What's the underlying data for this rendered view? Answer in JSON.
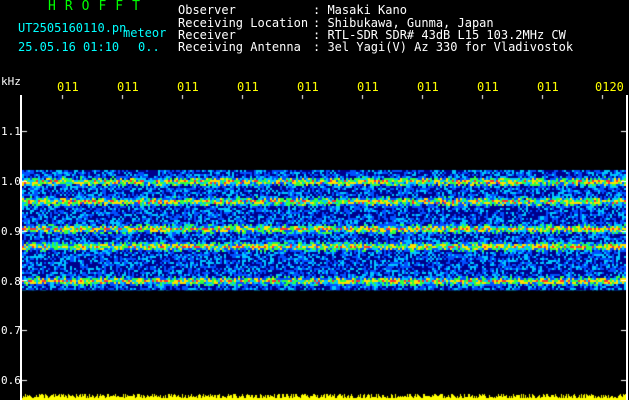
{
  "header": {
    "logo": "HROFFT",
    "filename": "UT2505160110.pn",
    "filename_suffix": "meteor",
    "datetime": "25.05.16 01:10",
    "dot_text": "0..",
    "fields": [
      {
        "label": "Observer",
        "value": ": Masaki Kano"
      },
      {
        "label": "Receiving Location",
        "value": ": Shibukawa, Gunma, Japan"
      },
      {
        "label": "Receiver",
        "value": ": RTL-SDR SDR# 43dB L15 103.2MHz CW"
      },
      {
        "label": "Receiving Antenna",
        "value": ": 3el Yagi(V) Az 330 for Vladivostok"
      }
    ]
  },
  "axis": {
    "unit": "kHz",
    "y_labels": [
      "1.1",
      "1.0",
      "0.9",
      "0.8",
      "0.7",
      "0.6"
    ],
    "x_labels": [
      "011",
      "011",
      "011",
      "011",
      "011",
      "011",
      "011",
      "011",
      "011",
      "0120"
    ]
  },
  "colors": {
    "grid": "#ffffff",
    "signal_low": "#0000c0",
    "signal_mid": "#00c8ff",
    "signal_high": "#ff2020",
    "level_bar": "#ffff00",
    "logo": "#00ff00"
  },
  "spectrogram": {
    "band_khz": [
      0.78,
      1.02
    ],
    "strong_lines_khz": [
      1.0,
      0.96,
      0.905,
      0.87,
      0.8
    ],
    "level_bar_khz": 0.6
  }
}
